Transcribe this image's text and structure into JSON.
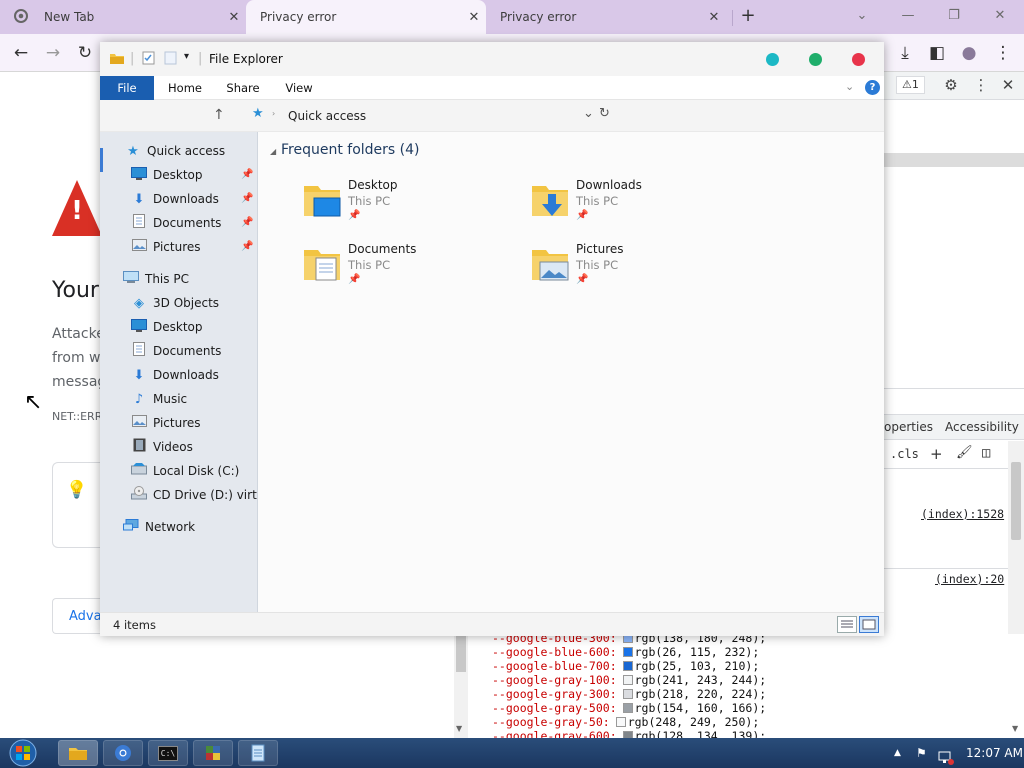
{
  "browser": {
    "tabs": [
      {
        "label": "New Tab",
        "close": "✕"
      },
      {
        "label": "Privacy error",
        "close": "✕"
      },
      {
        "label": "Privacy error",
        "close": "✕"
      }
    ],
    "new_tab": "+",
    "window_controls": {
      "search_tabs": "⌄",
      "minimize": "—",
      "restore": "❐",
      "close": "✕"
    },
    "toolbar": {
      "back": "←",
      "forward": "→",
      "reload": "↻",
      "download": "⤓",
      "sidepanel": "◧",
      "profile": "●",
      "menu": "⋮"
    }
  },
  "page": {
    "heading": "Your",
    "para_lines": [
      "Attacke",
      "from w",
      "messag"
    ],
    "error_code": "NET::ERR",
    "tip_icon": "💡",
    "advanced_button": "Adva",
    "cursor": "↖"
  },
  "devtools": {
    "issues_badge": "⚠1",
    "icons": {
      "settings": "⚙",
      "more": "⋮",
      "close": "✕"
    },
    "tabs": [
      "operties",
      "Accessibility"
    ],
    "cls_label": ".cls",
    "cls_icons": {
      "add": "+",
      "paint": "🖌",
      "toggle": "◫"
    },
    "source_links": [
      "(index):1528",
      "(index):20"
    ],
    "css_vars": [
      {
        "name": "--google-blue-300:",
        "color": "#8ab4f8",
        "value": "rgb(138, 180, 248);"
      },
      {
        "name": "--google-blue-600:",
        "color": "#1a73e8",
        "value": "rgb(26, 115, 232);"
      },
      {
        "name": "--google-blue-700:",
        "color": "#1967d2",
        "value": "rgb(25, 103, 210);"
      },
      {
        "name": "--google-gray-100:",
        "color": "#f1f3f4",
        "value": "rgb(241, 243, 244);"
      },
      {
        "name": "--google-gray-300:",
        "color": "#dadce0",
        "value": "rgb(218, 220, 224);"
      },
      {
        "name": "--google-gray-500:",
        "color": "#9aa0a6",
        "value": "rgb(154, 160, 166);"
      },
      {
        "name": "--google-gray-50:",
        "color": "#f8f9fa",
        "value": "rgb(248, 249, 250);"
      },
      {
        "name": "--google-gray-600:",
        "color": "#80868b",
        "value": "rgb(128, 134, 139);"
      }
    ]
  },
  "explorer": {
    "title": "File Explorer",
    "title_dots": [
      "#1cb8c5",
      "#1fae6b",
      "#e8344a"
    ],
    "ribbon_tabs": [
      "File",
      "Home",
      "Share",
      "View"
    ],
    "help": "?",
    "address": {
      "up": "↑",
      "location": "Quick access",
      "dropdown": "⌄",
      "refresh": "↻"
    },
    "nav": {
      "quick_access": "Quick access",
      "quick_items": [
        "Desktop",
        "Downloads",
        "Documents",
        "Pictures"
      ],
      "this_pc": "This PC",
      "pc_items": [
        "3D Objects",
        "Desktop",
        "Documents",
        "Downloads",
        "Music",
        "Pictures",
        "Videos",
        "Local Disk (C:)",
        "CD Drive (D:) virtio-"
      ],
      "network": "Network"
    },
    "section_title": "Frequent folders (4)",
    "folders": [
      {
        "name": "Desktop",
        "location": "This PC"
      },
      {
        "name": "Downloads",
        "location": "This PC"
      },
      {
        "name": "Documents",
        "location": "This PC"
      },
      {
        "name": "Pictures",
        "location": "This PC"
      }
    ],
    "status": "4 items"
  },
  "taskbar": {
    "start": "⊞",
    "cmd_label": "C:\\",
    "time": "12:07 AM",
    "tray_up": "▲",
    "tray_flag": "⚑",
    "tray_volume": "🔇"
  }
}
